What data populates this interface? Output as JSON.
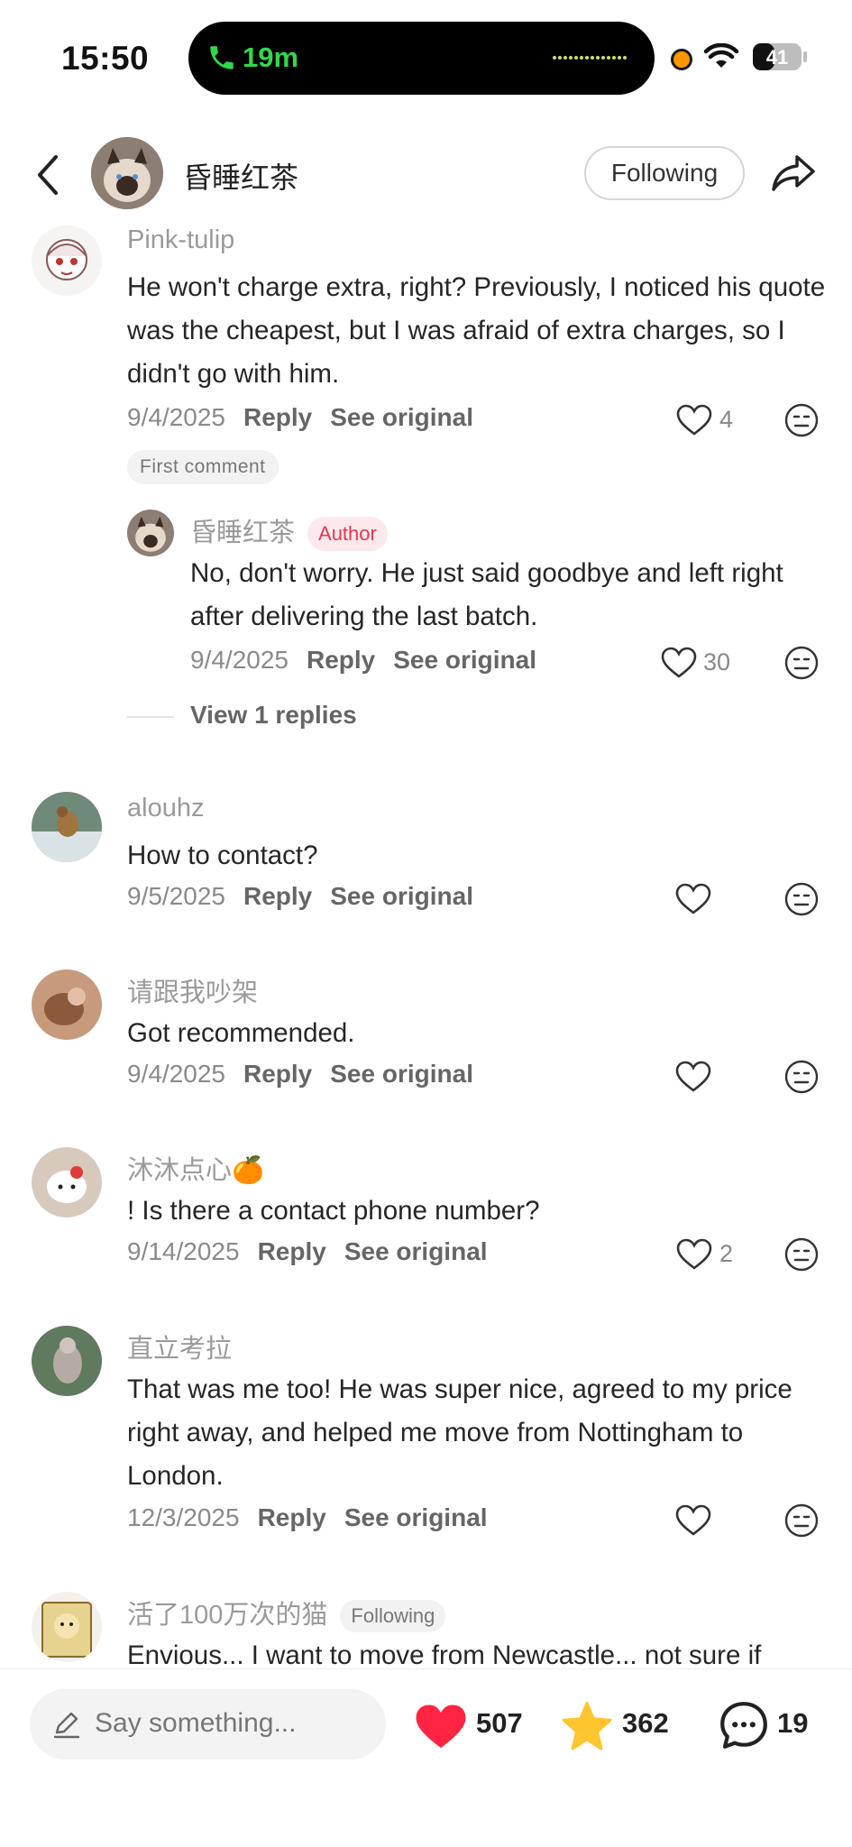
{
  "status_bar": {
    "time": "15:50",
    "call_duration": "19m",
    "battery": "41"
  },
  "header": {
    "title": "昏睡红茶",
    "follow_label": "Following"
  },
  "comments": [
    {
      "name": "Pink-tulip",
      "text": "He won't charge extra, right? Previously, I noticed his quote was the cheapest, but I was afraid of extra charges, so I didn't go with him.",
      "date": "9/4/2025",
      "reply_label": "Reply",
      "see_original_label": "See original",
      "likes": "4",
      "badge": "First comment"
    },
    {
      "name": "昏睡红茶",
      "author_badge": "Author",
      "text": "No, don't worry. He just said goodbye and left right after delivering the last batch.",
      "date": "9/4/2025",
      "reply_label": "Reply",
      "see_original_label": "See original",
      "likes": "30",
      "view_replies": "View 1 replies"
    },
    {
      "name": "alouhz",
      "text": "How to contact?",
      "date": "9/5/2025",
      "reply_label": "Reply",
      "see_original_label": "See original",
      "likes": ""
    },
    {
      "name": "请跟我吵架",
      "text": "Got recommended.",
      "date": "9/4/2025",
      "reply_label": "Reply",
      "see_original_label": "See original",
      "likes": ""
    },
    {
      "name": "沐沐点心🍊",
      "text": "! Is there a contact phone number?",
      "date": "9/14/2025",
      "reply_label": "Reply",
      "see_original_label": "See original",
      "likes": "2"
    },
    {
      "name": "直立考拉",
      "text": "That was me too! He was super nice, agreed to my price right away, and helped me move from Nottingham to London.",
      "date": "12/3/2025",
      "reply_label": "Reply",
      "see_original_label": "See original",
      "likes": ""
    },
    {
      "name": "活了100万次的猫",
      "follow_badge": "Following",
      "text": "Envious... I want to move from Newcastle... not sure if"
    }
  ],
  "bottom_bar": {
    "placeholder": "Say something...",
    "likes": "507",
    "stars": "362",
    "comments": "19"
  },
  "colors": {
    "accent_red": "#ff2442",
    "star_yellow": "#ffc42e",
    "author_tag": "#e8364f"
  },
  "icons": [
    "phone-icon",
    "wifi-icon",
    "battery-icon",
    "back-icon",
    "share-icon",
    "heart-icon",
    "dislike-face-icon",
    "pencil-icon",
    "star-icon",
    "comment-bubble-icon"
  ]
}
